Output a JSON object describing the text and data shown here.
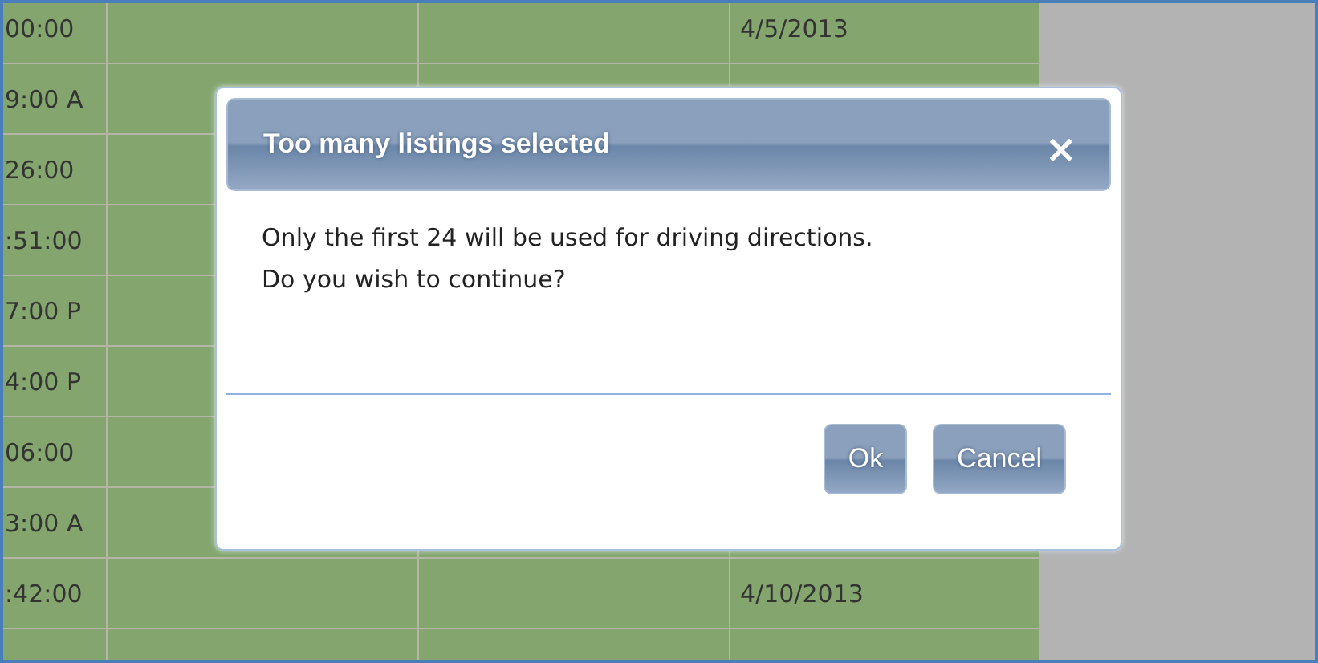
{
  "table": {
    "rows": [
      {
        "column_1": "00:00",
        "column_4": "4/5/2013"
      },
      {
        "column_1": "9:00 A"
      },
      {
        "column_1": "26:00"
      },
      {
        "column_1": ":51:00"
      },
      {
        "column_1": "7:00 P"
      },
      {
        "column_1": "4:00 P"
      },
      {
        "column_1": "06:00"
      },
      {
        "column_1": "3:00 A"
      },
      {
        "column_1": ":42:00",
        "column_4": "4/10/2013"
      },
      {}
    ]
  },
  "dialog": {
    "title": "Too many listings selected",
    "close": "×",
    "message": [
      "Only the first 24 will be used for driving directions.",
      "Do you wish to continue?"
    ],
    "buttons": [
      "Ok",
      "Cancel"
    ]
  }
}
